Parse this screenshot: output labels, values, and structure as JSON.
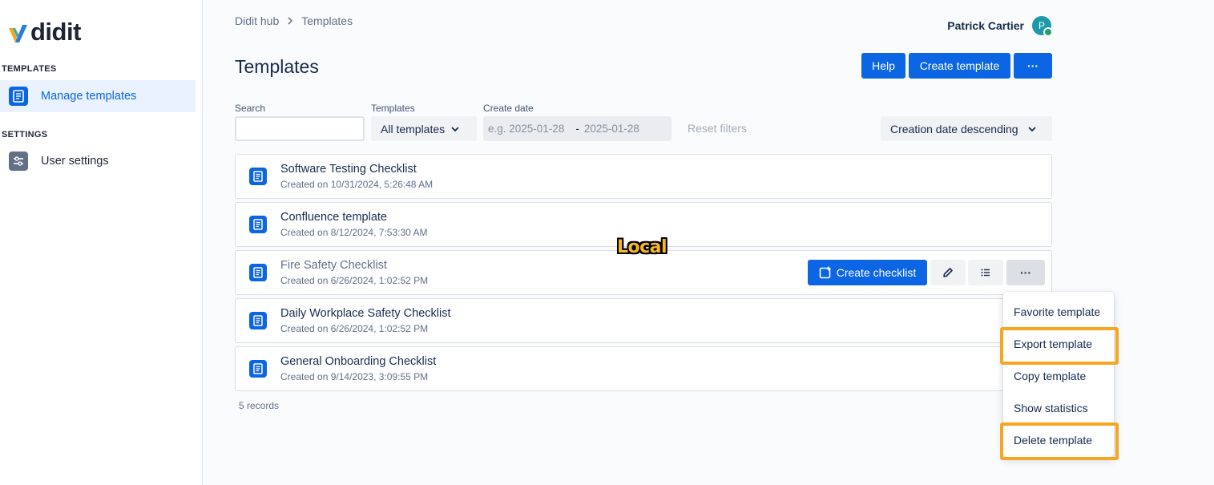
{
  "brand": {
    "name": "didit"
  },
  "sidebar": {
    "sections": [
      {
        "label": "TEMPLATES",
        "items": [
          {
            "label": "Manage templates",
            "icon": "document-icon",
            "active": true
          }
        ]
      },
      {
        "label": "SETTINGS",
        "items": [
          {
            "label": "User settings",
            "icon": "sliders-icon",
            "active": false
          }
        ]
      }
    ]
  },
  "breadcrumb": {
    "root": "Didit hub",
    "separator": ">",
    "current": "Templates"
  },
  "user": {
    "name": "Patrick Cartier",
    "initial": "P"
  },
  "page": {
    "title": "Templates"
  },
  "header_actions": {
    "help": "Help",
    "create": "Create template",
    "more": "···"
  },
  "filters": {
    "search_label": "Search",
    "search_value": "",
    "templates_label": "Templates",
    "templates_value": "All templates",
    "date_label": "Create date",
    "date_from_placeholder": "e.g. 2025-01-28",
    "date_separator": "-",
    "date_to_placeholder": "2025-01-28",
    "reset": "Reset filters",
    "sort_value": "Creation date descending"
  },
  "templates": [
    {
      "title": "Software Testing Checklist",
      "created": "Created on 10/31/2024, 5:26:48 AM"
    },
    {
      "title": "Confluence template",
      "created": "Created on 8/12/2024, 7:53:30 AM"
    },
    {
      "title": "Fire Safety Checklist",
      "created": "Created on 6/26/2024, 1:02:52 PM"
    },
    {
      "title": "Daily Workplace Safety Checklist",
      "created": "Created on 6/26/2024, 1:02:52 PM"
    },
    {
      "title": "General Onboarding Checklist",
      "created": "Created on 9/14/2023, 3:09:55 PM"
    }
  ],
  "row_actions": {
    "create_checklist": "Create checklist",
    "edit_icon": "pencil-icon",
    "list_icon": "list-icon",
    "more": "···"
  },
  "records": "5 records",
  "menu": {
    "items": [
      {
        "label": "Favorite template",
        "highlighted": false
      },
      {
        "label": "Export template",
        "highlighted": true
      },
      {
        "label": "Copy template",
        "highlighted": false
      },
      {
        "label": "Show statistics",
        "highlighted": false
      },
      {
        "label": "Delete template",
        "highlighted": true
      }
    ]
  },
  "overlay_label": "Local",
  "colors": {
    "accent": "#0c66e4",
    "highlight": "#f5a623",
    "active_bg": "#e9f2fe"
  }
}
